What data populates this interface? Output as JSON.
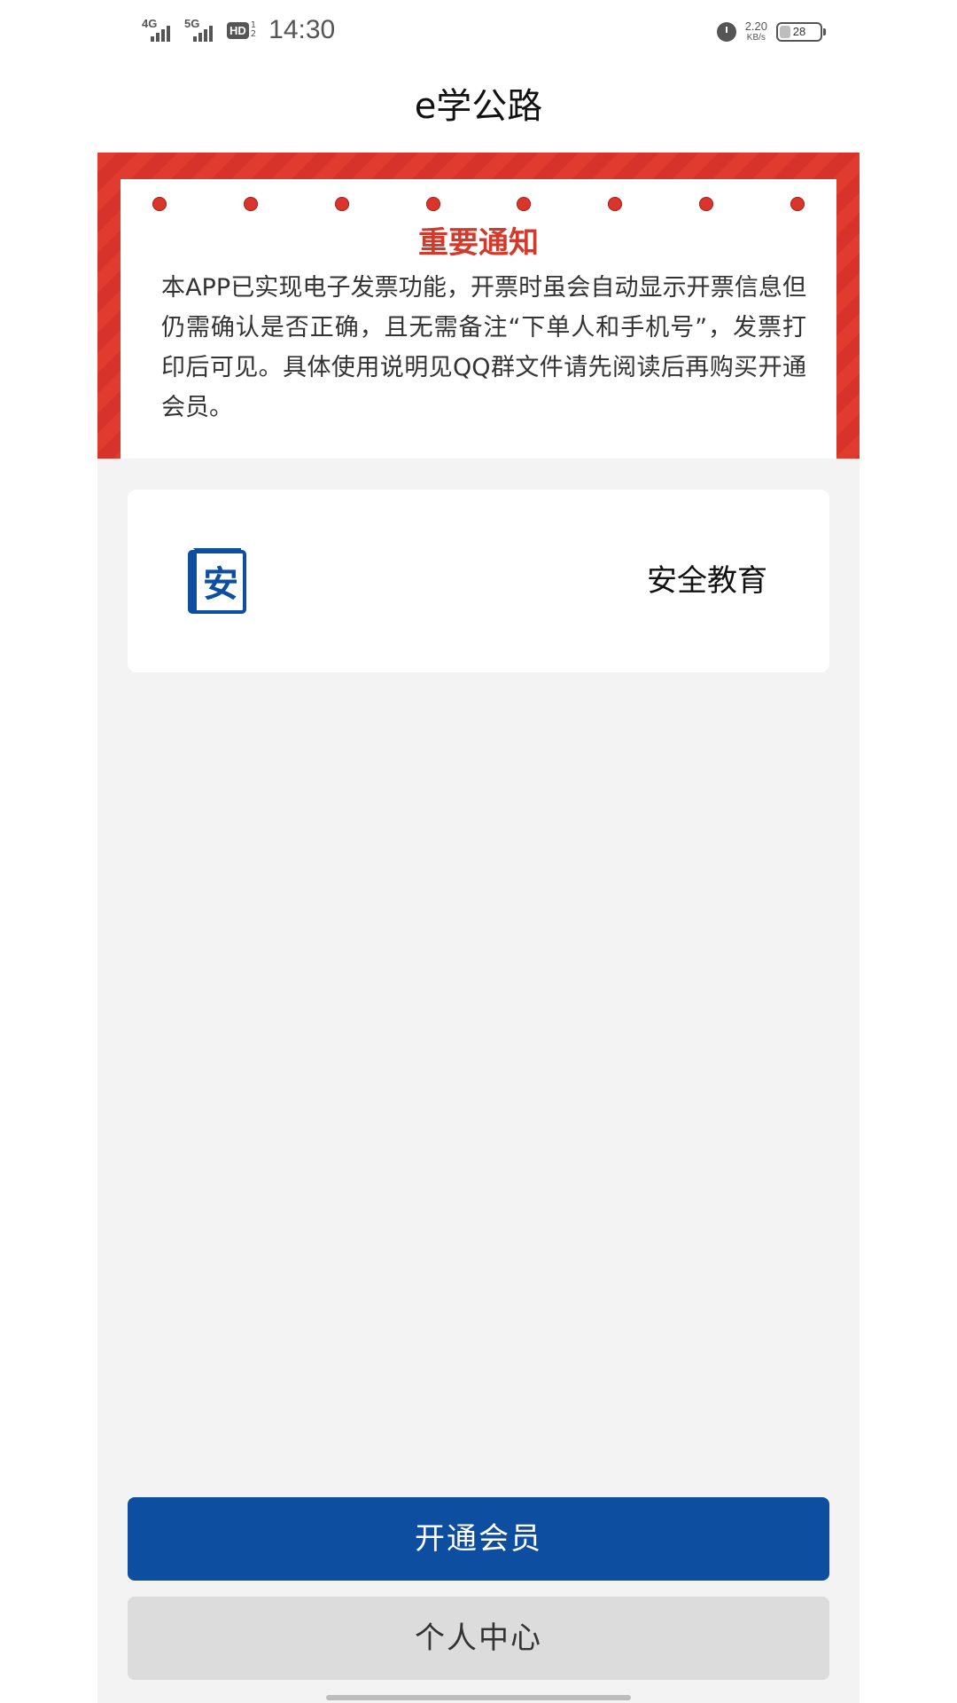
{
  "status_bar": {
    "net1": "4G",
    "net2": "5G",
    "hd": "HD",
    "sim_top": "1",
    "sim_bottom": "2",
    "time": "14:30",
    "speed_value": "2.20",
    "speed_unit": "KB/s",
    "battery_level": "28",
    "icons": [
      "signal-icon",
      "hd-icon",
      "alarm-icon",
      "battery-icon"
    ]
  },
  "header": {
    "title": "e学公路"
  },
  "notice": {
    "title": "重要通知",
    "body": "本APP已实现电子发票功能，开票时虽会自动显示开票信息但仍需确认是否正确，且无需备注“下单人和手机号”，发票打印后可见。具体使用说明见QQ群文件请先阅读后再购买开通会员。",
    "dot_count": 8
  },
  "course": {
    "icon_glyph": "安",
    "label": "安全教育"
  },
  "buttons": {
    "primary": "开通会员",
    "secondary": "个人中心"
  },
  "colors": {
    "brand_blue": "#0d4ea1",
    "notice_red": "#d33a2c",
    "content_bg": "#f3f3f3"
  }
}
